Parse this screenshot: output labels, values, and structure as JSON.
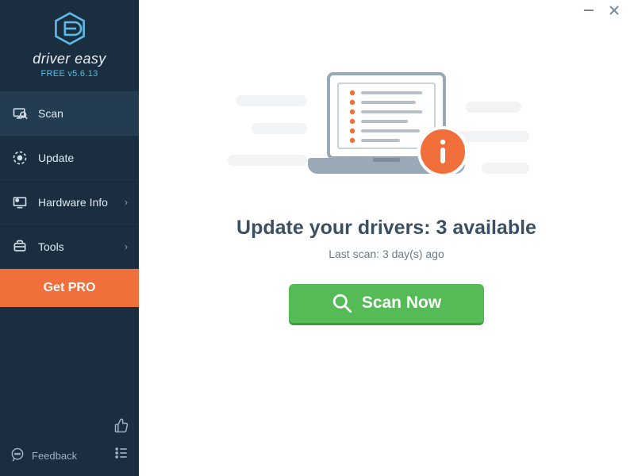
{
  "brand": {
    "name": "driver easy",
    "version": "FREE v5.6.13"
  },
  "nav": {
    "items": [
      {
        "id": "scan",
        "label": "Scan",
        "chevron": false
      },
      {
        "id": "update",
        "label": "Update",
        "chevron": false
      },
      {
        "id": "hardware",
        "label": "Hardware Info",
        "chevron": true
      },
      {
        "id": "tools",
        "label": "Tools",
        "chevron": true
      }
    ]
  },
  "getpro": {
    "label": "Get PRO"
  },
  "feedback": {
    "label": "Feedback"
  },
  "main": {
    "headline": "Update your drivers: 3 available",
    "subtext": "Last scan: 3 day(s) ago",
    "scan_label": "Scan Now"
  }
}
